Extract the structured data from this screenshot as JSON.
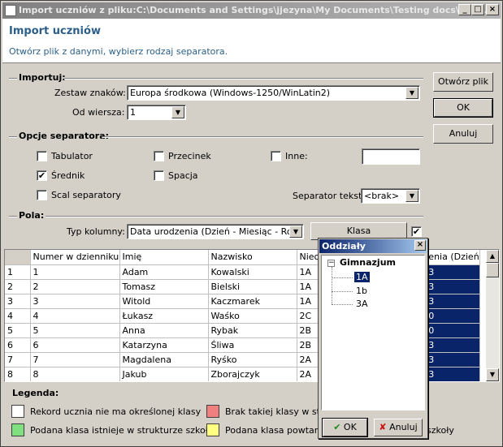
{
  "window": {
    "title": "Import uczniów z pliku:C:\\Documents and Settings\\jjezyna\\My Documents\\Testing docs\\Moj...",
    "btn_min": "_",
    "btn_max": "□",
    "btn_close": "×"
  },
  "header": {
    "title": "Import uczniów",
    "subtitle": "Otwórz plik z danymi, wybierz rodzaj separatora."
  },
  "buttons": {
    "open": "Otwórz plik",
    "ok": "OK",
    "cancel": "Anuluj"
  },
  "import": {
    "group": "Importuj:",
    "charset_label": "Zestaw znaków:",
    "charset_value": "Europa środkowa (Windows-1250/WinLatin2)",
    "from_row_label": "Od wiersza:",
    "from_row_value": "1"
  },
  "separator": {
    "group": "Opcje separatora:",
    "tab": "Tabulator",
    "comma": "Przecinek",
    "other": "Inne:",
    "semicolon": "Średnik",
    "space": "Spacja",
    "merge": "Scal separatory",
    "text_sep_label": "Separator tekstu",
    "text_sep_value": "<brak>",
    "check_mark": "✔"
  },
  "fields": {
    "group": "Pola:",
    "col_type_label": "Typ kolumny:",
    "col_type_value": "Data urodzenia (Dzień - Miesiąc - Rok)",
    "klasa_button": "Klasa"
  },
  "grid": {
    "columns": [
      "",
      "Numer w dzienniku",
      "Imię",
      "Nazwisko",
      "Nieo",
      "",
      "enia (Dzień"
    ],
    "rows": [
      [
        "1",
        "1",
        "Adam",
        "Kowalski",
        "1A",
        "",
        "3"
      ],
      [
        "2",
        "2",
        "Tomasz",
        "Bielski",
        "1A",
        "",
        "3"
      ],
      [
        "3",
        "3",
        "Witold",
        "Kaczmarek",
        "1A",
        "",
        "3"
      ],
      [
        "4",
        "4",
        "Łukasz",
        "Waśko",
        "2C",
        "",
        "0"
      ],
      [
        "5",
        "5",
        "Anna",
        "Rybak",
        "2B",
        "",
        "0"
      ],
      [
        "6",
        "6",
        "Katarzyna",
        "Śliwa",
        "2B",
        "",
        "3"
      ],
      [
        "7",
        "7",
        "Magdalena",
        "Ryśko",
        "2A",
        "",
        "3"
      ],
      [
        "8",
        "8",
        "Jakub",
        "Zborajczyk",
        "2A",
        "",
        "3"
      ]
    ]
  },
  "legend": {
    "title": "Legenda:",
    "items": [
      {
        "text": "Rekord ucznia nie ma określonej klasy",
        "color": "#ffffff"
      },
      {
        "text": "Brak takiej klasy w struk",
        "color": "#f08080"
      },
      {
        "text": "Podana klasa istnieje w strukturze szkoły",
        "color": "#80e080"
      },
      {
        "text": "Podana klasa powtarza",
        "color": "#ffff80"
      }
    ],
    "tail": "szkoły"
  },
  "popup": {
    "title": "Oddziały",
    "root": "Gimnazjum",
    "expander": "−",
    "children": [
      "1A",
      "1b",
      "3A"
    ],
    "ok": "OK",
    "cancel": "Anuluj"
  },
  "colors": {
    "selected": "#0a246a",
    "titlebar_inactive": "#808080"
  }
}
